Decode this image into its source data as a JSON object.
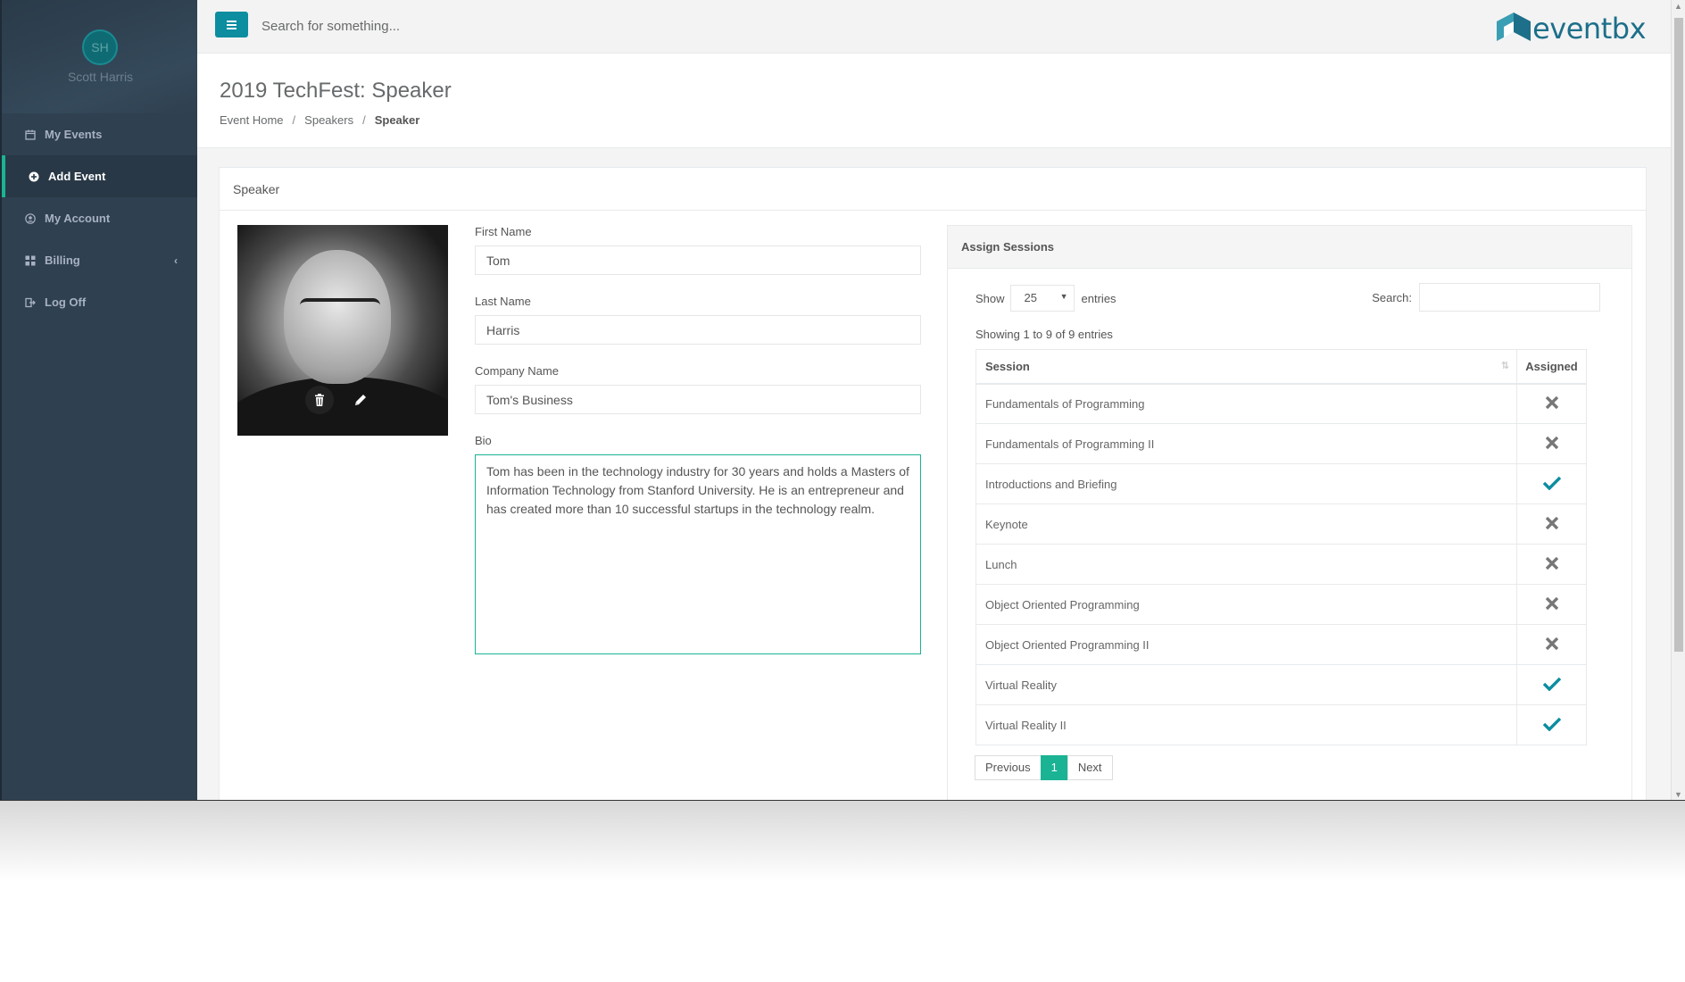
{
  "user": {
    "initials": "SH",
    "name": "Scott Harris"
  },
  "sidebar": {
    "items": [
      {
        "label": "My Events",
        "icon": "calendar-icon"
      },
      {
        "label": "Add Event",
        "icon": "plus-circle-icon",
        "active": true
      },
      {
        "label": "My Account",
        "icon": "user-circle-icon"
      },
      {
        "label": "Billing",
        "icon": "grid-icon",
        "caret": "‹"
      },
      {
        "label": "Log Off",
        "icon": "sign-out-icon"
      }
    ]
  },
  "topbar": {
    "search_placeholder": "Search for something...",
    "logo_text": "eventbx"
  },
  "page": {
    "title": "2019 TechFest: Speaker",
    "breadcrumb": [
      "Event Home",
      "Speakers",
      "Speaker"
    ],
    "breadcrumb_sep": "/"
  },
  "speaker_panel": {
    "title": "Speaker",
    "fields": {
      "first_name_label": "First Name",
      "first_name": "Tom",
      "last_name_label": "Last Name",
      "last_name": "Harris",
      "company_label": "Company Name",
      "company": "Tom's Business",
      "bio_label": "Bio",
      "bio": "Tom has been in the technology industry for 30 years and holds a Masters of Information Technology from Stanford University. He is an entrepreneur and has created more than 10 successful startups in the technology realm."
    }
  },
  "sessions": {
    "title": "Assign Sessions",
    "show_label": "Show",
    "page_size": "25",
    "entries_label": "entries",
    "search_label": "Search:",
    "info": "Showing 1 to 9 of 9 entries",
    "columns": [
      "Session",
      "Assigned"
    ],
    "rows": [
      {
        "name": "Fundamentals of Programming",
        "assigned": false
      },
      {
        "name": "Fundamentals of Programming II",
        "assigned": false
      },
      {
        "name": "Introductions and Briefing",
        "assigned": true
      },
      {
        "name": "Keynote",
        "assigned": false
      },
      {
        "name": "Lunch",
        "assigned": false
      },
      {
        "name": "Object Oriented Programming",
        "assigned": false
      },
      {
        "name": "Object Oriented Programming II",
        "assigned": false
      },
      {
        "name": "Virtual Reality",
        "assigned": true
      },
      {
        "name": "Virtual Reality II",
        "assigned": true
      }
    ],
    "pager": {
      "previous": "Previous",
      "current": "1",
      "next": "Next"
    }
  },
  "colors": {
    "sidebar": "#2f4050",
    "accent": "#1ab394",
    "check": "#0c8da0",
    "cross": "#777777"
  }
}
